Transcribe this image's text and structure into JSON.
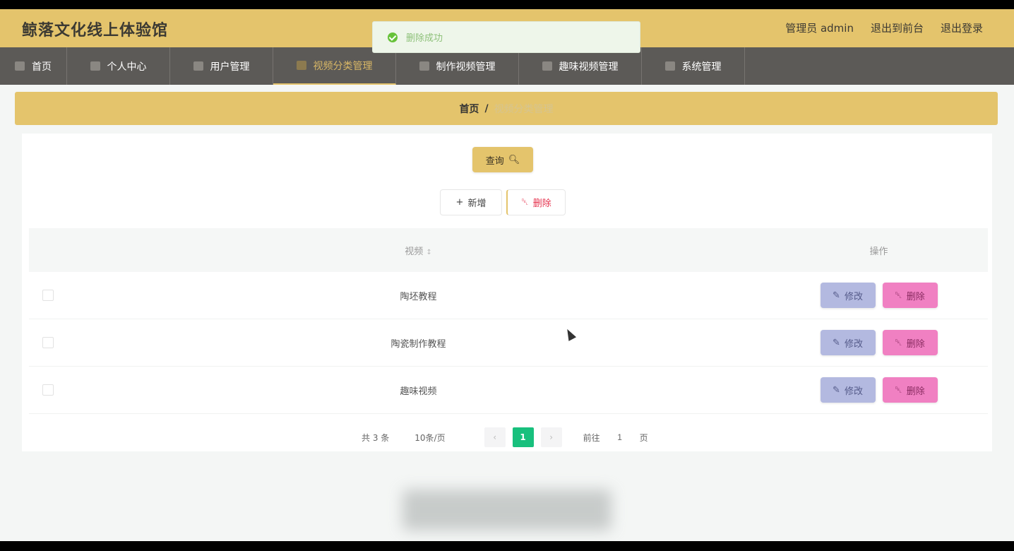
{
  "header": {
    "title": "鲸落文化线上体验馆",
    "user": "管理员 admin",
    "to_frontend": "退出到前台",
    "logout": "退出登录"
  },
  "toast": {
    "text": "删除成功"
  },
  "nav": {
    "items": [
      {
        "label": "首页",
        "icon": "home-icon"
      },
      {
        "label": "个人中心",
        "icon": "user-icon"
      },
      {
        "label": "用户管理",
        "icon": "list-icon"
      },
      {
        "label": "视频分类管理",
        "icon": "list-icon"
      },
      {
        "label": "制作视频管理",
        "icon": "video-icon"
      },
      {
        "label": "趣味视频管理",
        "icon": "video-icon"
      },
      {
        "label": "系统管理",
        "icon": "settings-icon"
      }
    ],
    "active_index": 3
  },
  "breadcrumb": {
    "home": "首页",
    "separator": "/",
    "current": "视频分类管理"
  },
  "toolbar": {
    "query_label": "查询",
    "add_label": "新增",
    "delete_label": "删除"
  },
  "table": {
    "columns": {
      "name": "视频",
      "op": "操作"
    },
    "rows": [
      {
        "name": "陶坯教程"
      },
      {
        "name": "陶瓷制作教程"
      },
      {
        "name": "趣味视频"
      }
    ],
    "edit_label": "修改",
    "delete_label": "删除"
  },
  "pagination": {
    "total": "共 3 条",
    "page_size": "10条/页",
    "current_page": "1",
    "goto_prefix": "前往",
    "goto_value": "1",
    "goto_suffix": "页"
  },
  "colors": {
    "accent": "#e4c46c",
    "nav_bg": "#5c5a57",
    "page_active": "#18c07d",
    "edit_btn": "#b3b9e0",
    "delete_btn": "#f080c2"
  }
}
